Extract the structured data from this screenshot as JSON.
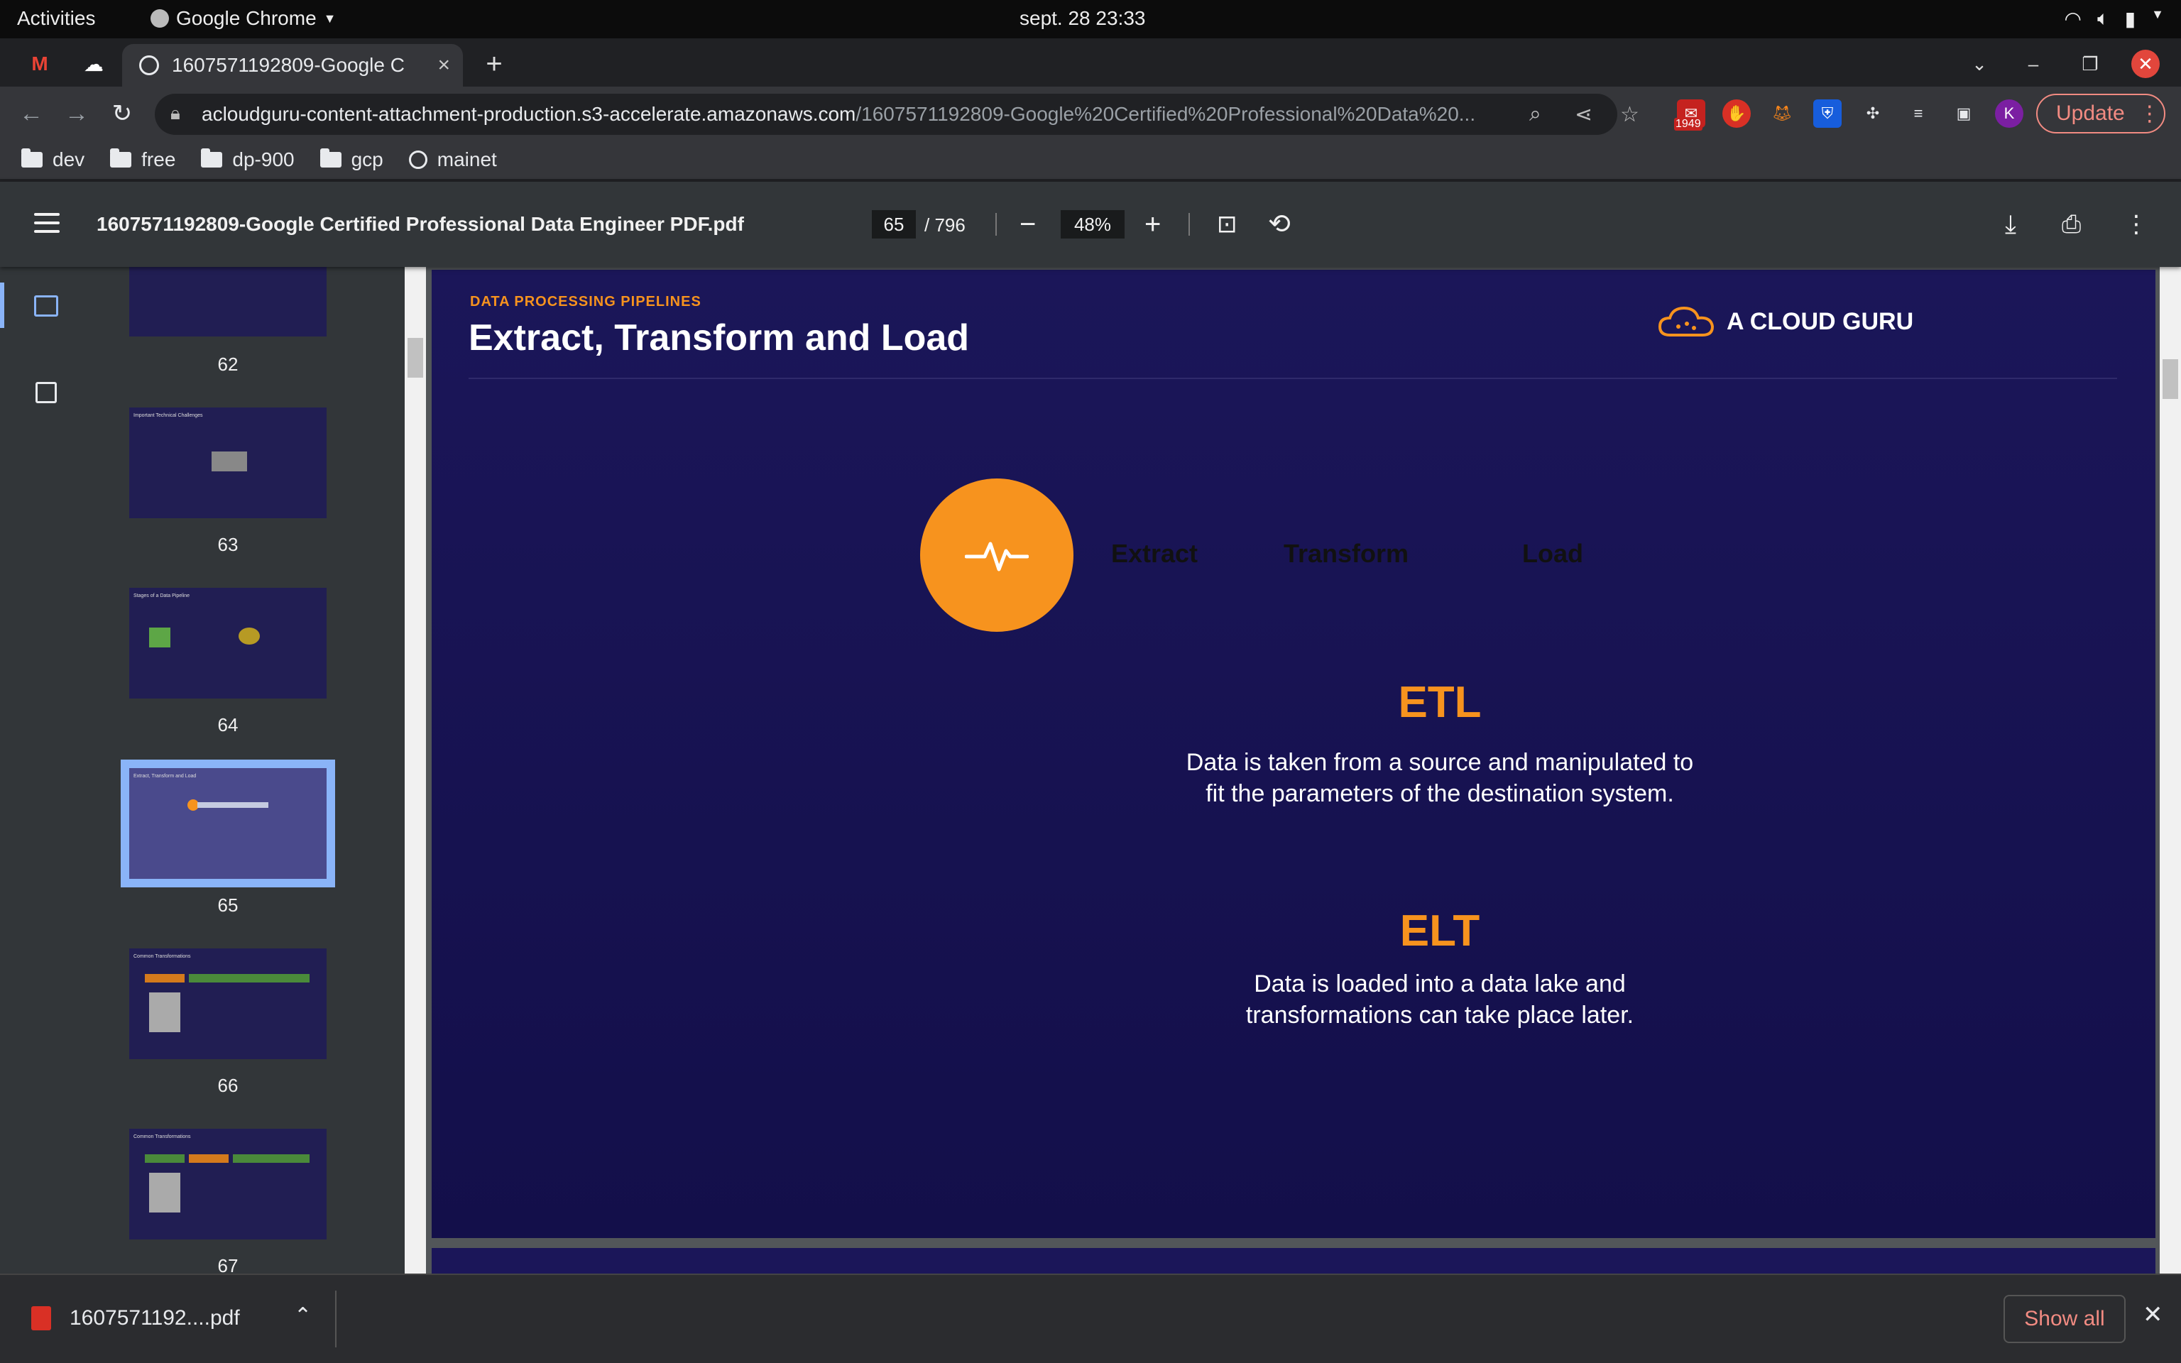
{
  "system": {
    "activities": "Activities",
    "app_name": "Google Chrome",
    "clock": "sept. 28  23:33"
  },
  "tab": {
    "title": "1607571192809-Google C",
    "close": "×",
    "new_tab": "+"
  },
  "address": {
    "host": "acloudguru-content-attachment-production.s3-accelerate.amazonaws.com",
    "path": "/1607571192809-Google%20Certified%20Professional%20Data%20...",
    "badge_count": "1949",
    "profile_initial": "K",
    "update_label": "Update"
  },
  "bookmarks": [
    {
      "label": "dev",
      "icon": "folder-icon"
    },
    {
      "label": "free",
      "icon": "folder-icon"
    },
    {
      "label": "dp-900",
      "icon": "folder-icon"
    },
    {
      "label": "gcp",
      "icon": "folder-icon"
    },
    {
      "label": "mainet",
      "icon": "globe-icon"
    }
  ],
  "pdf": {
    "filename": "1607571192809-Google Certified Professional Data Engineer PDF.pdf",
    "current_page": "65",
    "total_pages": "/ 796",
    "zoom": "48%"
  },
  "thumbnails": [
    {
      "num": "62",
      "title": ""
    },
    {
      "num": "63",
      "title": "Important Technical Challenges"
    },
    {
      "num": "64",
      "title": "Stages of a Data Pipeline"
    },
    {
      "num": "65",
      "title": "Extract, Transform and Load"
    },
    {
      "num": "66",
      "title": "Common Transformations"
    },
    {
      "num": "67",
      "title": "Common Transformations"
    }
  ],
  "slide": {
    "kicker": "DATA PROCESSING PIPELINES",
    "heading": "Extract, Transform and Load",
    "brand": "A CLOUD GURU",
    "steps": [
      "Extract",
      "Transform",
      "Load"
    ],
    "etl_title": "ETL",
    "etl_text": "Data is taken from a source and manipulated to fit the parameters of the destination system.",
    "elt_title": "ELT",
    "elt_text": "Data is loaded into a data lake and transformations can take place later."
  },
  "download": {
    "filename": "1607571192....pdf",
    "show_all": "Show all"
  },
  "colors": {
    "accent": "#f7931e",
    "slide_bg": "#1b1659",
    "chevron": "#c5cbe0"
  }
}
